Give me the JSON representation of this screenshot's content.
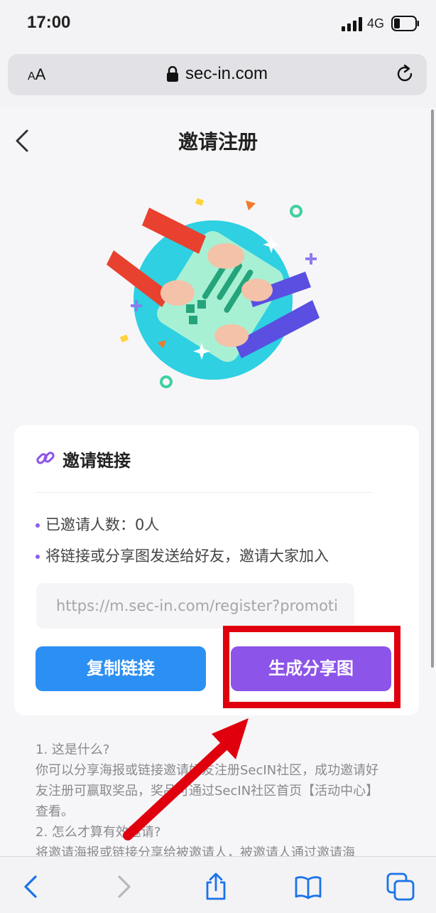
{
  "status_bar": {
    "time": "17:00",
    "network": "4G"
  },
  "browser": {
    "text_size_label_small": "A",
    "text_size_label_big": "A",
    "url": "sec-in.com"
  },
  "page": {
    "title": "邀请注册",
    "card": {
      "title": "邀请链接",
      "invited_count": "已邀请人数：0人",
      "instruction": "将链接或分享图发送给好友，邀请大家加入",
      "invite_url": "https://m.sec-in.com/register?promoti",
      "copy_button": "复制链接",
      "share_button": "生成分享图"
    },
    "help": [
      "1. 这是什么?",
      "你可以分享海报或链接邀请好友注册SecIN社区，成功邀请好友注册可赢取奖品，奖品可通过SecIN社区首页【活动中心】查看。",
      "2. 怎么才算有效邀请?",
      "将邀请海报或链接分享给被邀请人，被邀请人通过邀请海"
    ]
  },
  "colors": {
    "accent_blue": "#2c8ff3",
    "accent_purple": "#8c54e8",
    "annotation_red": "#e0000d",
    "ios_blue": "#1a73e8"
  },
  "icons": [
    "signal-icon",
    "battery-icon",
    "lock-icon",
    "reload-icon",
    "back-icon",
    "link-icon",
    "toolbar-back-icon",
    "toolbar-forward-icon",
    "share-icon",
    "bookmarks-icon",
    "tabs-icon"
  ]
}
